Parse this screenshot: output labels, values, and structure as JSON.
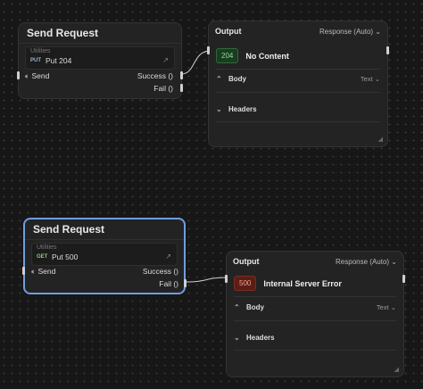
{
  "nodes": [
    {
      "title": "Send Request",
      "category": "Utilities",
      "method": "PUT",
      "request_name": "Put 204",
      "send_label": "Send",
      "success_label": "Success ()",
      "fail_label": "Fail ()"
    },
    {
      "title": "Send Request",
      "category": "Utilities",
      "method": "GET",
      "request_name": "Put 500",
      "send_label": "Send",
      "success_label": "Success ()",
      "fail_label": "Fail ()"
    }
  ],
  "outputs": [
    {
      "title": "Output",
      "mode": "Response (Auto)",
      "status_code": "204",
      "status_text": "No Content",
      "body_label": "Body",
      "body_format": "Text",
      "headers_label": "Headers"
    },
    {
      "title": "Output",
      "mode": "Response (Auto)",
      "status_code": "500",
      "status_text": "Internal Server Error",
      "body_label": "Body",
      "body_format": "Text",
      "headers_label": "Headers"
    }
  ],
  "colors": {
    "selected_border": "#6f9de0",
    "success_badge": "#1c3b23",
    "error_badge": "#5a1e16"
  }
}
